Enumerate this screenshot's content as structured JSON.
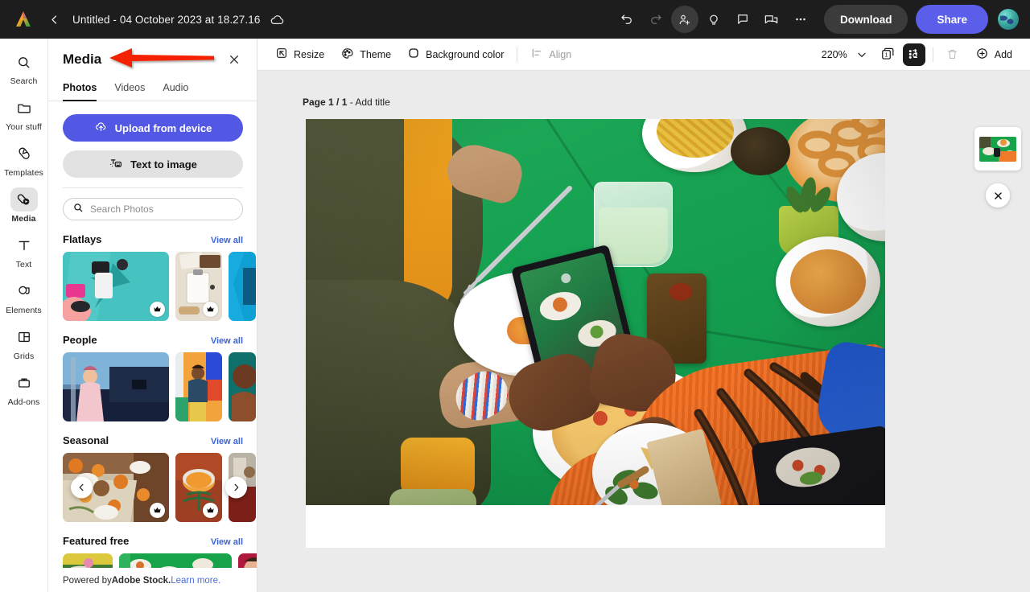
{
  "topbar": {
    "logo_icon": "adobe-express-logo",
    "back_icon": "chevron-left-icon",
    "title": "Untitled - 04 October 2023 at 18.27.16",
    "cloud_icon": "cloud-saved-icon",
    "undo_icon": "undo-icon",
    "redo_icon": "redo-icon",
    "invite_icon": "invite-person-icon",
    "ideas_icon": "lightbulb-icon",
    "comment_icon": "comment-icon",
    "chat_icon": "chat-bubbles-icon",
    "more_icon": "more-options-icon",
    "download_label": "Download",
    "share_label": "Share",
    "avatar_icon": "user-avatar"
  },
  "rail": {
    "items": [
      {
        "label": "Search",
        "icon": "search-icon",
        "active": false
      },
      {
        "label": "Your stuff",
        "icon": "folder-icon",
        "active": false
      },
      {
        "label": "Templates",
        "icon": "templates-icon",
        "active": false
      },
      {
        "label": "Media",
        "icon": "media-icon",
        "active": true
      },
      {
        "label": "Text",
        "icon": "text-icon",
        "active": false
      },
      {
        "label": "Elements",
        "icon": "elements-icon",
        "active": false
      },
      {
        "label": "Grids",
        "icon": "grids-icon",
        "active": false
      },
      {
        "label": "Add-ons",
        "icon": "addons-icon",
        "active": false
      }
    ]
  },
  "panel": {
    "title": "Media",
    "close_icon": "close-icon",
    "tabs": [
      {
        "label": "Photos",
        "active": true
      },
      {
        "label": "Videos",
        "active": false
      },
      {
        "label": "Audio",
        "active": false
      }
    ],
    "upload_label": "Upload from device",
    "upload_icon": "upload-cloud-icon",
    "text_to_image_label": "Text to image",
    "text_to_image_icon": "text-to-image-icon",
    "search": {
      "placeholder": "Search Photos",
      "value": "",
      "icon": "search-icon"
    },
    "view_all_label": "View all",
    "sections": [
      {
        "title": "Flatlays",
        "view_all": "View all"
      },
      {
        "title": "People",
        "view_all": "View all"
      },
      {
        "title": "Seasonal",
        "view_all": "View all"
      },
      {
        "title": "Featured free",
        "view_all": "View all"
      }
    ],
    "carousel": {
      "prev_icon": "chevron-left-icon",
      "next_icon": "chevron-right-icon"
    },
    "premium_badge_icon": "premium-crown-icon",
    "footer": {
      "prefix": "Powered by ",
      "brand": "Adobe Stock.",
      "link": " Learn more."
    }
  },
  "canvas_toolbar": {
    "resize_label": "Resize",
    "resize_icon": "resize-icon",
    "theme_label": "Theme",
    "theme_icon": "palette-icon",
    "background_color_label": "Background color",
    "background_color_icon": "color-swatch-icon",
    "align_label": "Align",
    "align_icon": "align-icon",
    "zoom_value": "220%",
    "zoom_caret_icon": "chevron-down-icon",
    "pages_icon": "pages-count-icon",
    "pages_count": "1",
    "animation_icon": "animate-icon",
    "delete_icon": "trash-icon",
    "add_label": "Add",
    "add_icon": "plus-circle-icon"
  },
  "canvas": {
    "page_label_bold": "Page 1 / 1",
    "page_label_rest": " - Add title",
    "artwork_alt": "overhead photo of friends sharing food at a green table"
  },
  "page_strip": {
    "thumb_name": "page-1-thumbnail",
    "close_icon": "close-icon"
  },
  "annotation": {
    "arrow": "red-left-arrow",
    "color": "#f42000"
  },
  "colors": {
    "topbar_bg": "#1d1d1d",
    "accent_purple": "#5258e4",
    "share_purple": "#5a5ee8",
    "link_blue": "#3b63d8",
    "canvas_bg": "#ebebeb",
    "panel_bg": "#ffffff",
    "annotation_red": "#f42000"
  }
}
